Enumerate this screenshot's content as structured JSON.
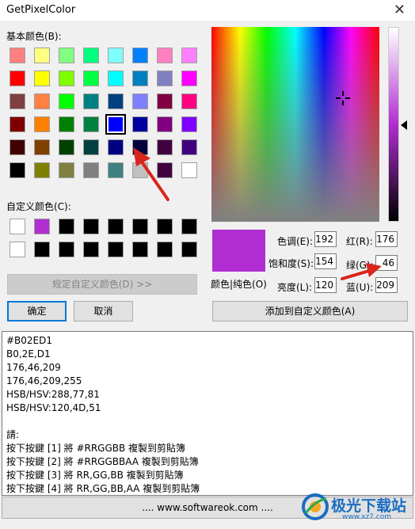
{
  "window": {
    "title": "GetPixelColor",
    "close_glyph": "✕"
  },
  "basic": {
    "label": "基本颜色(B):",
    "rows": [
      [
        "#ff8080",
        "#ffff80",
        "#80ff80",
        "#00ff80",
        "#80ffff",
        "#0080ff",
        "#ff80c0",
        "#ff80ff"
      ],
      [
        "#ff0000",
        "#ffff00",
        "#80ff00",
        "#00ff40",
        "#00ffff",
        "#0080c0",
        "#8080c0",
        "#ff00ff"
      ],
      [
        "#804040",
        "#ff8040",
        "#00ff00",
        "#008080",
        "#004080",
        "#8080ff",
        "#800040",
        "#ff0080"
      ],
      [
        "#800000",
        "#ff8000",
        "#008000",
        "#008040",
        "#0000ff",
        "#0000a0",
        "#800080",
        "#8000ff"
      ],
      [
        "#400000",
        "#804000",
        "#004000",
        "#004040",
        "#000080",
        "#000040",
        "#400040",
        "#400080"
      ],
      [
        "#000000",
        "#808000",
        "#808040",
        "#808080",
        "#408080",
        "#c0c0c0",
        "#400040",
        "#ffffff"
      ]
    ],
    "selected": [
      3,
      4
    ]
  },
  "custom": {
    "label": "自定义颜色(C):",
    "rows": [
      [
        "#ffffff",
        "#b02ed1",
        "#000000",
        "#000000",
        "#000000",
        "#000000",
        "#000000",
        "#000000"
      ],
      [
        "#ffffff",
        "#000000",
        "#000000",
        "#000000",
        "#000000",
        "#000000",
        "#000000",
        "#000000"
      ]
    ]
  },
  "buttons": {
    "define_custom": "规定自定义颜色(D) >>",
    "ok": "确定",
    "cancel": "取消",
    "add_custom": "添加到自定义颜色(A)"
  },
  "color": {
    "hex": "#b02ed1",
    "preview_label": "颜色|纯色(O)",
    "hue_label": "色调(E):",
    "hue": "192",
    "sat_label": "饱和度(S):",
    "sat": "154",
    "lum_label": "亮度(L):",
    "lum": "120",
    "red_label": "红(R):",
    "red": "176",
    "green_label": "绿(G):",
    "green": "46",
    "blue_label": "蓝(U):",
    "blue": "209"
  },
  "output_lines": [
    "#B02ED1",
    "B0,2E,D1",
    "176,46,209",
    "176,46,209,255",
    "HSB/HSV:288,77,81",
    "HSB/HSV:120,4D,51",
    "",
    "請:",
    "按下按鍵 [1] 將 #RRGGBB 複製到剪貼簿",
    "按下按鍵 [2] 將 #RRGGBBAA 複製到剪貼簿",
    "按下按鍵 [3] 將 RR,GG,BB 複製到剪貼簿",
    "按下按鍵 [4] 將 RR,GG,BB,AA 複製到剪貼簿"
  ],
  "footer": ".... www.softwareok.com ....",
  "watermark": {
    "text": "极光下载站",
    "url": "www.xz7.com"
  },
  "annotation_color": "#d9251c"
}
